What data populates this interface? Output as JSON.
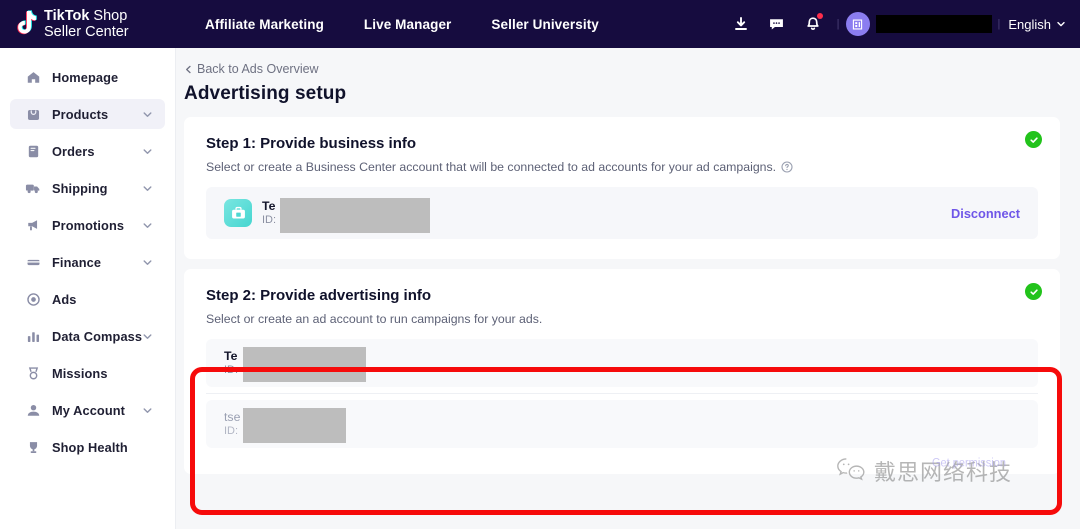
{
  "topnav": {
    "brand_line1_bold": "TikTok",
    "brand_line1_rest": " Shop",
    "brand_line2": "Seller Center",
    "links": [
      {
        "label": "Affiliate Marketing",
        "name": "nav-affiliate-marketing"
      },
      {
        "label": "Live Manager",
        "name": "nav-live-manager"
      },
      {
        "label": "Seller University",
        "name": "nav-seller-university"
      }
    ],
    "icons": [
      {
        "name": "download-icon",
        "glyph": "download"
      },
      {
        "name": "message-icon",
        "glyph": "message"
      },
      {
        "name": "notification-bell-icon",
        "glyph": "bell",
        "has_badge": true
      }
    ],
    "separator": "|",
    "user_name_redacted": "",
    "language": "English",
    "bg_color": "#160c3f"
  },
  "sidebar": {
    "items": [
      {
        "label": "Homepage",
        "icon": "home-icon",
        "expandable": false,
        "active": false
      },
      {
        "label": "Products",
        "icon": "bag-icon",
        "expandable": true,
        "active": true
      },
      {
        "label": "Orders",
        "icon": "order-book-icon",
        "expandable": true,
        "active": false
      },
      {
        "label": "Shipping",
        "icon": "truck-icon",
        "expandable": true,
        "active": false
      },
      {
        "label": "Promotions",
        "icon": "megaphone-icon",
        "expandable": true,
        "active": false
      },
      {
        "label": "Finance",
        "icon": "card-icon",
        "expandable": true,
        "active": false
      },
      {
        "label": "Ads",
        "icon": "ads-target-icon",
        "expandable": false,
        "active": false
      },
      {
        "label": "Data Compass",
        "icon": "bar-chart-icon",
        "expandable": true,
        "active": false
      },
      {
        "label": "Missions",
        "icon": "medal-icon",
        "expandable": false,
        "active": false
      },
      {
        "label": "My Account",
        "icon": "person-icon",
        "expandable": true,
        "active": false
      },
      {
        "label": "Shop Health",
        "icon": "trophy-icon",
        "expandable": false,
        "active": false
      }
    ]
  },
  "main": {
    "back_link": "Back to Ads Overview",
    "page_title": "Advertising setup",
    "step1": {
      "title": "Step 1: Provide business info",
      "subtitle": "Select or create a Business Center account that will be connected to ad accounts for your ad campaigns.",
      "status": "complete",
      "account": {
        "name": "Te",
        "id_label": "ID:",
        "id_value_redacted": ""
      },
      "disconnect_label": "Disconnect"
    },
    "step2": {
      "title": "Step 2: Provide advertising info",
      "subtitle": "Select or create an ad account to run campaigns for your ads.",
      "status": "complete",
      "accounts": [
        {
          "name": "Te",
          "id_label": "ID:",
          "id_value_redacted": "",
          "muted": false
        },
        {
          "name": "tse",
          "id_label": "ID:",
          "id_value_redacted": "",
          "muted": true
        }
      ]
    }
  },
  "annotation": {
    "type": "highlight-rectangle",
    "color": "#f60b0b"
  },
  "watermark": {
    "icon": "wechat-icon",
    "text": "戴思网络科技",
    "ghost_text": "Get permission"
  },
  "colors": {
    "nav_bg": "#160c3f",
    "page_bg": "#f6f7f9",
    "accent_purple": "#6f56e8",
    "success_green": "#22c31b",
    "annotation_red": "#f60b0b"
  }
}
